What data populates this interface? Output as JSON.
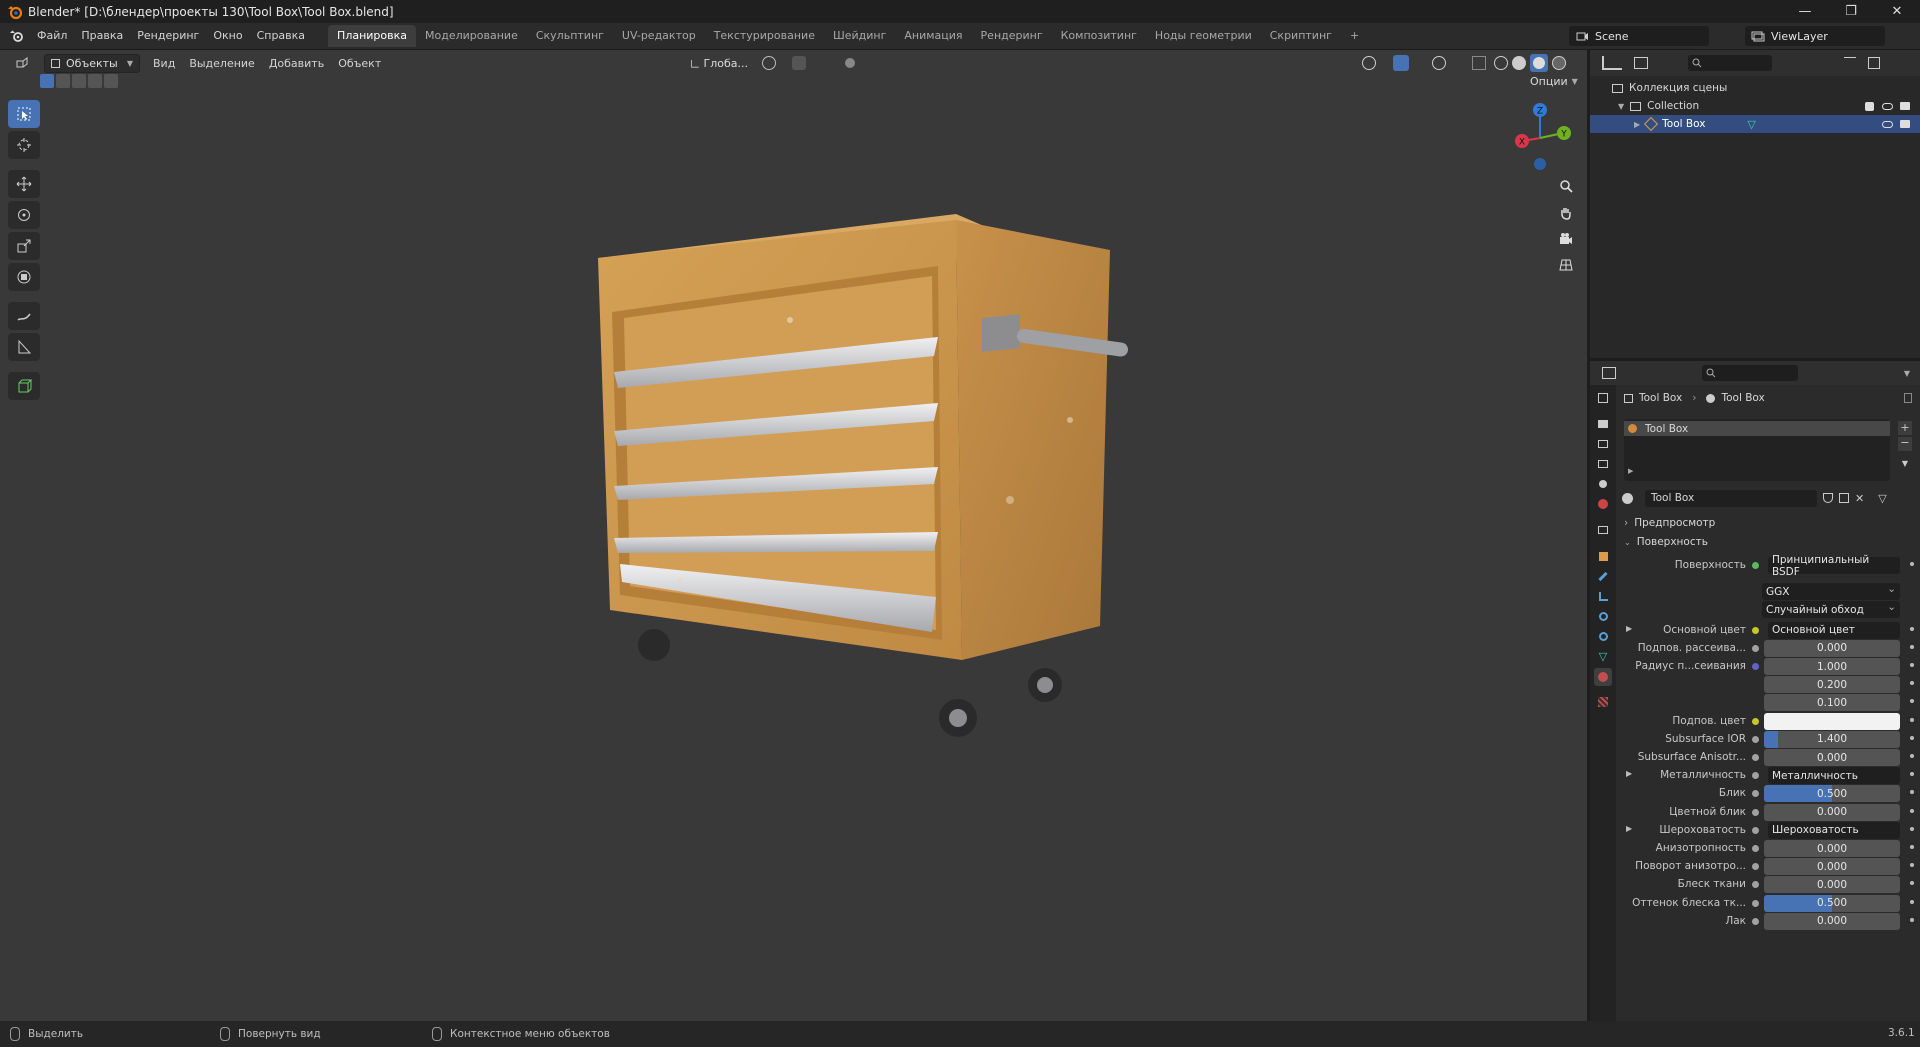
{
  "window": {
    "title": "Blender* [D:\\блендер\\проекты 130\\Tool Box\\Tool Box.blend]",
    "controls": [
      "—",
      "❐",
      "✕"
    ]
  },
  "menu": [
    "Файл",
    "Правка",
    "Рендеринг",
    "Окно",
    "Справка"
  ],
  "workspaces": {
    "tabs": [
      "Планировка",
      "Моделирование",
      "Скульптинг",
      "UV-редактор",
      "Текстурирование",
      "Шейдинг",
      "Анимация",
      "Рендеринг",
      "Композитинг",
      "Ноды геометрии",
      "Скриптинг"
    ],
    "active": "Планировка",
    "add": "+"
  },
  "scene": {
    "scene_name": "Scene",
    "view_layer": "ViewLayer"
  },
  "viewport_header": {
    "mode": "Объекты",
    "menus": [
      "Вид",
      "Выделение",
      "Добавить",
      "Объект"
    ],
    "transform_orientation": "Глоба...",
    "options": "Опции"
  },
  "gizmo": {
    "x": "X",
    "y": "Y",
    "z": "Z"
  },
  "outliner": {
    "root": "Коллекция сцены",
    "collection": "Collection",
    "object": "Tool Box"
  },
  "properties": {
    "breadcrumb_object": "Tool Box",
    "breadcrumb_material": "Tool Box",
    "slot_name": "Tool Box",
    "material_name": "Tool Box",
    "panel_preview": "Предпросмотр",
    "panel_surface": "Поверхность",
    "rows": [
      {
        "label": "Поверхность",
        "value": "Принципиальный BSDF",
        "kind": "link",
        "socket": "#5cb85c"
      },
      {
        "label": "",
        "value": "GGX",
        "kind": "dropdown"
      },
      {
        "label": "",
        "value": "Случайный обход",
        "kind": "dropdown"
      },
      {
        "label": "Основной цвет",
        "value": "Основной цвет",
        "kind": "link",
        "socket": "#c7c729",
        "expand": true
      },
      {
        "label": "Подпов. рассеива...",
        "value": "0.000",
        "kind": "number",
        "socket": "#a1a1a1",
        "fill": 0
      },
      {
        "label": "Радиус п...сеивания",
        "value": "1.000",
        "kind": "number",
        "socket": "#6363c7",
        "fill": 0
      },
      {
        "label": "",
        "value": "0.200",
        "kind": "number",
        "fill": 0
      },
      {
        "label": "",
        "value": "0.100",
        "kind": "number",
        "fill": 0
      },
      {
        "label": "Подпов. цвет",
        "value": "",
        "kind": "color",
        "socket": "#c7c729"
      },
      {
        "label": "Subsurface IOR",
        "value": "1.400",
        "kind": "number",
        "socket": "#a1a1a1",
        "fill": 0.1
      },
      {
        "label": "Subsurface Anisotr...",
        "value": "0.000",
        "kind": "number",
        "socket": "#a1a1a1",
        "fill": 0
      },
      {
        "label": "Металличность",
        "value": "Металличность",
        "kind": "link",
        "socket": "#a1a1a1",
        "expand": true
      },
      {
        "label": "Блик",
        "value": "0.500",
        "kind": "number",
        "socket": "#a1a1a1",
        "fill": 0.5
      },
      {
        "label": "Цветной блик",
        "value": "0.000",
        "kind": "number",
        "socket": "#a1a1a1",
        "fill": 0
      },
      {
        "label": "Шероховатость",
        "value": "Шероховатость",
        "kind": "link",
        "socket": "#a1a1a1",
        "expand": true
      },
      {
        "label": "Анизотропность",
        "value": "0.000",
        "kind": "number",
        "socket": "#a1a1a1",
        "fill": 0
      },
      {
        "label": "Поворот анизотро...",
        "value": "0.000",
        "kind": "number",
        "socket": "#a1a1a1",
        "fill": 0
      },
      {
        "label": "Блеск ткани",
        "value": "0.000",
        "kind": "number",
        "socket": "#a1a1a1",
        "fill": 0
      },
      {
        "label": "Оттенок блеска тк...",
        "value": "0.500",
        "kind": "number",
        "socket": "#a1a1a1",
        "fill": 0.5
      },
      {
        "label": "Лак",
        "value": "0.000",
        "kind": "number",
        "socket": "#a1a1a1",
        "fill": 0
      }
    ]
  },
  "statusbar": {
    "select": "Выделить",
    "rotate": "Повернуть вид",
    "context": "Контекстное меню объектов",
    "version": "3.6.1"
  },
  "colors": {
    "accent": "#4772b3",
    "selection": "#334d80",
    "viewport_bg": "#393939",
    "toolbox": "#d9a25a"
  }
}
